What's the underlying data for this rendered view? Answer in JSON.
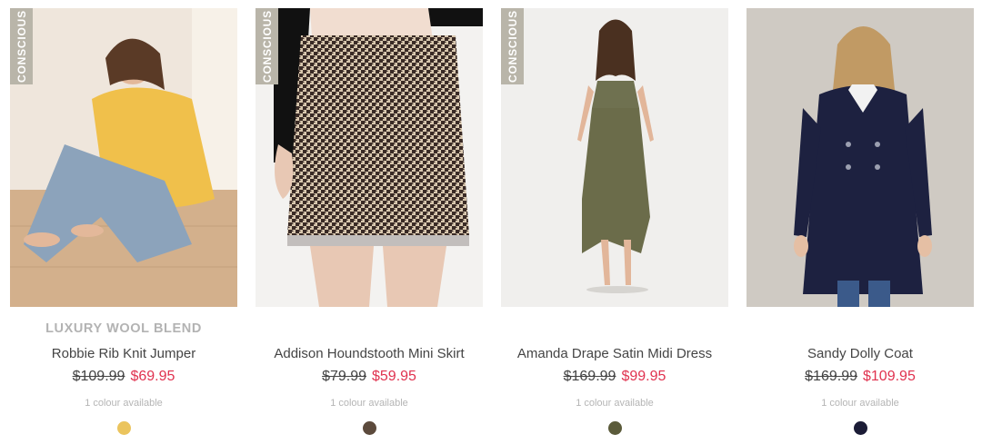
{
  "products": [
    {
      "badge": "CONSCIOUS",
      "feature": "LUXURY WOOL BLEND",
      "name": "Robbie Rib Knit Jumper",
      "was_price": "$109.99",
      "now_price": "$69.95",
      "colours": "1 colour available",
      "swatch_color": "#ebc45d"
    },
    {
      "badge": "CONSCIOUS",
      "feature": "",
      "name": "Addison Houndstooth Mini Skirt",
      "was_price": "$79.99",
      "now_price": "$59.95",
      "colours": "1 colour available",
      "swatch_color": "#5c4a3c"
    },
    {
      "badge": "CONSCIOUS",
      "feature": "",
      "name": "Amanda Drape Satin Midi Dress",
      "was_price": "$169.99",
      "now_price": "$99.95",
      "colours": "1 colour available",
      "swatch_color": "#5b5b3a"
    },
    {
      "badge": "",
      "feature": "",
      "name": "Sandy Dolly Coat",
      "was_price": "$169.99",
      "now_price": "$109.95",
      "colours": "1 colour available",
      "swatch_color": "#1b1c36"
    }
  ]
}
